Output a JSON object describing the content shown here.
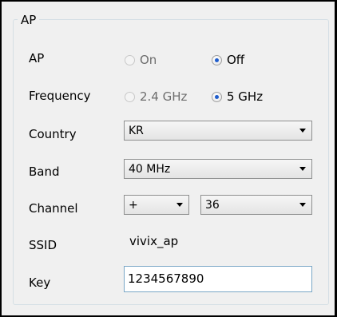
{
  "group": {
    "title": "AP"
  },
  "ap": {
    "label": "AP",
    "options": [
      {
        "label": "On",
        "checked": false
      },
      {
        "label": "Off",
        "checked": true
      }
    ]
  },
  "frequency": {
    "label": "Frequency",
    "options": [
      {
        "label": "2.4 GHz",
        "checked": false
      },
      {
        "label": "5 GHz",
        "checked": true
      }
    ]
  },
  "country": {
    "label": "Country",
    "value": "KR"
  },
  "band": {
    "label": "Band",
    "value": "40 MHz"
  },
  "channel": {
    "label": "Channel",
    "offset_value": "+",
    "number_value": "36"
  },
  "ssid": {
    "label": "SSID",
    "value": "vivix_ap"
  },
  "key": {
    "label": "Key",
    "value": "1234567890"
  }
}
